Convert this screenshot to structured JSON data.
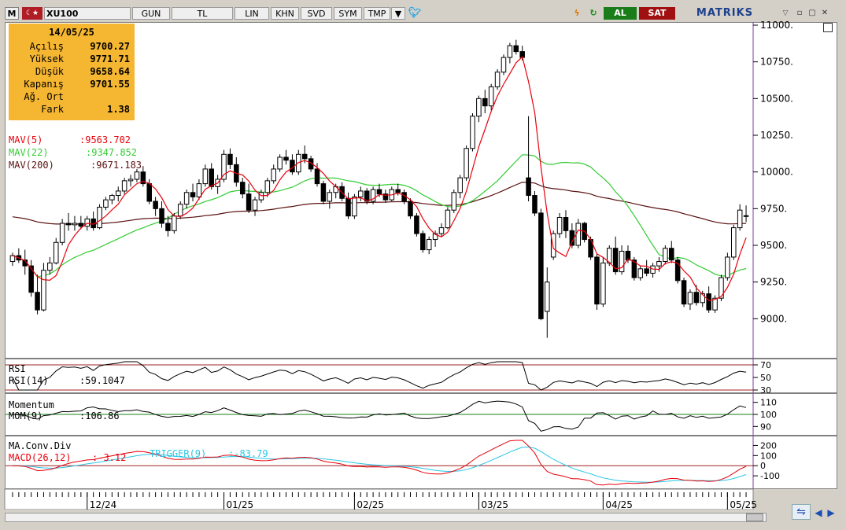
{
  "window": {
    "symbol": "XU100",
    "buttons": [
      "GUN",
      "TL",
      "LIN",
      "KHN",
      "SVD",
      "SYM",
      "TMP"
    ],
    "buy_label": "AL",
    "sell_label": "SAT",
    "brand": "MATRIKS"
  },
  "infobox": {
    "date": "14/05/25",
    "rows": [
      {
        "label": "Açılış",
        "value": "9700.27"
      },
      {
        "label": "Yüksek",
        "value": "9771.71"
      },
      {
        "label": "Düşük",
        "value": "9658.64"
      },
      {
        "label": "Kapanış",
        "value": "9701.55"
      },
      {
        "label": "Ağ. Ort",
        "value": ""
      },
      {
        "label": "Fark",
        "value": "1.38"
      }
    ]
  },
  "colors": {
    "mav5": "#e8000b",
    "mav22": "#33cc33",
    "mav200": "#5a1010",
    "macd": "#e8000b",
    "trigger": "#29c6e6",
    "price_bg": "#ffffff",
    "info_bg": "#f5b631"
  },
  "legends": {
    "mav5": {
      "name": "MAV(5)",
      "value": ":9563.702"
    },
    "mav22": {
      "name": "MAV(22)",
      "value": ":9347.852"
    },
    "mav200": {
      "name": "MAV(200)",
      "value": ":9671.183"
    },
    "rsi_title": "RSI",
    "rsi": {
      "name": "RSI(14)",
      "value": ":59.1047"
    },
    "mom_title": "Momentum",
    "mom": {
      "name": "MOM(9)",
      "value": ":106.86"
    },
    "macd_title": "MA.Conv.Div",
    "macd": {
      "name": "MACD(26,12)",
      "value": ":-3.12"
    },
    "trigger": {
      "name": "TRIGGER(9)",
      "value": ":-83.79"
    }
  },
  "chart_data": [
    {
      "type": "candlestick",
      "title": "XU100",
      "ylim": [
        8750,
        11000
      ],
      "y_ticks": [
        "11000.",
        "10750.",
        "10500.",
        "10250.",
        "10000.",
        "9750.",
        "9500.",
        "9250.",
        "9000."
      ],
      "x_ticks": [
        "12/24",
        "01/25",
        "02/25",
        "03/25",
        "04/25",
        "05/25"
      ],
      "candles": [
        [
          9390,
          9450,
          9360,
          9430
        ],
        [
          9430,
          9480,
          9380,
          9400
        ],
        [
          9400,
          9470,
          9300,
          9360
        ],
        [
          9360,
          9400,
          9150,
          9180
        ],
        [
          9180,
          9300,
          9030,
          9060
        ],
        [
          9060,
          9380,
          9050,
          9330
        ],
        [
          9330,
          9420,
          9300,
          9380
        ],
        [
          9380,
          9550,
          9370,
          9520
        ],
        [
          9520,
          9680,
          9500,
          9650
        ],
        [
          9650,
          9720,
          9600,
          9640
        ],
        [
          9640,
          9700,
          9600,
          9650
        ],
        [
          9650,
          9700,
          9610,
          9630
        ],
        [
          9630,
          9700,
          9600,
          9680
        ],
        [
          9680,
          9730,
          9600,
          9620
        ],
        [
          9620,
          9780,
          9610,
          9760
        ],
        [
          9760,
          9830,
          9740,
          9810
        ],
        [
          9810,
          9850,
          9780,
          9840
        ],
        [
          9840,
          9900,
          9800,
          9870
        ],
        [
          9870,
          9960,
          9850,
          9940
        ],
        [
          9940,
          9980,
          9900,
          9950
        ],
        [
          9950,
          10020,
          9930,
          10000
        ],
        [
          10000,
          10040,
          9900,
          9920
        ],
        [
          9920,
          9950,
          9780,
          9800
        ],
        [
          9800,
          9830,
          9700,
          9750
        ],
        [
          9750,
          9800,
          9620,
          9650
        ],
        [
          9650,
          9700,
          9560,
          9600
        ],
        [
          9600,
          9720,
          9580,
          9700
        ],
        [
          9700,
          9800,
          9680,
          9780
        ],
        [
          9780,
          9880,
          9750,
          9860
        ],
        [
          9860,
          9920,
          9800,
          9830
        ],
        [
          9830,
          9950,
          9810,
          9920
        ],
        [
          9920,
          10050,
          9900,
          10020
        ],
        [
          10020,
          10060,
          9880,
          9900
        ],
        [
          9900,
          9980,
          9850,
          9950
        ],
        [
          9950,
          10150,
          9930,
          10120
        ],
        [
          10120,
          10160,
          10020,
          10050
        ],
        [
          10050,
          10100,
          9900,
          9930
        ],
        [
          9930,
          9960,
          9820,
          9850
        ],
        [
          9850,
          9920,
          9720,
          9740
        ],
        [
          9740,
          9830,
          9700,
          9810
        ],
        [
          9810,
          9880,
          9790,
          9860
        ],
        [
          9860,
          9960,
          9830,
          9940
        ],
        [
          9940,
          10050,
          9920,
          10020
        ],
        [
          10020,
          10120,
          10000,
          10100
        ],
        [
          10100,
          10150,
          10050,
          10080
        ],
        [
          10080,
          10120,
          9980,
          10000
        ],
        [
          10000,
          10150,
          9980,
          10120
        ],
        [
          10120,
          10180,
          10060,
          10090
        ],
        [
          10090,
          10110,
          10000,
          10020
        ],
        [
          10020,
          10060,
          9900,
          9920
        ],
        [
          9920,
          9940,
          9780,
          9800
        ],
        [
          9800,
          9880,
          9750,
          9860
        ],
        [
          9860,
          9920,
          9820,
          9900
        ],
        [
          9900,
          9930,
          9800,
          9820
        ],
        [
          9820,
          9860,
          9680,
          9700
        ],
        [
          9700,
          9850,
          9680,
          9830
        ],
        [
          9830,
          9900,
          9800,
          9870
        ],
        [
          9870,
          9890,
          9780,
          9800
        ],
        [
          9800,
          9900,
          9780,
          9880
        ],
        [
          9880,
          9920,
          9830,
          9850
        ],
        [
          9850,
          9880,
          9790,
          9810
        ],
        [
          9810,
          9900,
          9800,
          9880
        ],
        [
          9880,
          9920,
          9840,
          9860
        ],
        [
          9860,
          9880,
          9780,
          9800
        ],
        [
          9800,
          9820,
          9680,
          9700
        ],
        [
          9700,
          9720,
          9560,
          9580
        ],
        [
          9580,
          9600,
          9450,
          9470
        ],
        [
          9470,
          9560,
          9440,
          9540
        ],
        [
          9540,
          9600,
          9490,
          9580
        ],
        [
          9580,
          9650,
          9560,
          9620
        ],
        [
          9620,
          9760,
          9610,
          9740
        ],
        [
          9740,
          9880,
          9720,
          9860
        ],
        [
          9860,
          9980,
          9820,
          9960
        ],
        [
          9960,
          10180,
          9940,
          10160
        ],
        [
          10160,
          10400,
          10140,
          10380
        ],
        [
          10380,
          10520,
          10340,
          10500
        ],
        [
          10500,
          10560,
          10400,
          10450
        ],
        [
          10450,
          10600,
          10420,
          10580
        ],
        [
          10580,
          10700,
          10560,
          10680
        ],
        [
          10680,
          10800,
          10660,
          10780
        ],
        [
          10780,
          10880,
          10740,
          10860
        ],
        [
          10860,
          10900,
          10800,
          10820
        ],
        [
          10820,
          10860,
          10760,
          10780
        ],
        [
          9960,
          10380,
          9800,
          9840
        ],
        [
          9840,
          9870,
          9700,
          9720
        ],
        [
          9720,
          9750,
          8990,
          9000
        ],
        [
          9050,
          9350,
          8870,
          9250
        ],
        [
          9420,
          9600,
          9400,
          9580
        ],
        [
          9580,
          9720,
          9550,
          9690
        ],
        [
          9690,
          9740,
          9550,
          9600
        ],
        [
          9600,
          9650,
          9480,
          9500
        ],
        [
          9500,
          9680,
          9480,
          9650
        ],
        [
          9650,
          9660,
          9520,
          9540
        ],
        [
          9540,
          9560,
          9400,
          9420
        ],
        [
          9420,
          9440,
          9060,
          9100
        ],
        [
          9100,
          9420,
          9080,
          9380
        ],
        [
          9380,
          9500,
          9360,
          9480
        ],
        [
          9480,
          9560,
          9300,
          9320
        ],
        [
          9320,
          9500,
          9300,
          9460
        ],
        [
          9460,
          9500,
          9380,
          9400
        ],
        [
          9400,
          9420,
          9260,
          9280
        ],
        [
          9280,
          9360,
          9260,
          9340
        ],
        [
          9340,
          9400,
          9290,
          9310
        ],
        [
          9310,
          9380,
          9280,
          9360
        ],
        [
          9360,
          9420,
          9320,
          9390
        ],
        [
          9390,
          9500,
          9370,
          9480
        ],
        [
          9480,
          9530,
          9380,
          9400
        ],
        [
          9400,
          9420,
          9240,
          9260
        ],
        [
          9260,
          9280,
          9080,
          9100
        ],
        [
          9100,
          9200,
          9060,
          9180
        ],
        [
          9180,
          9230,
          9090,
          9110
        ],
        [
          9110,
          9190,
          9080,
          9170
        ],
        [
          9170,
          9220,
          9040,
          9060
        ],
        [
          9060,
          9160,
          9040,
          9140
        ],
        [
          9140,
          9300,
          9120,
          9280
        ],
        [
          9280,
          9450,
          9260,
          9420
        ],
        [
          9420,
          9640,
          9400,
          9620
        ],
        [
          9620,
          9780,
          9600,
          9740
        ],
        [
          9700,
          9772,
          9659,
          9702
        ]
      ]
    },
    {
      "type": "line",
      "title": "RSI",
      "series": [
        {
          "name": "RSI(14)"
        }
      ],
      "last_value": 59.1047,
      "ylim": [
        30,
        75
      ],
      "y_ticks": [
        "70",
        "50",
        "30"
      ]
    },
    {
      "type": "line",
      "title": "Momentum",
      "series": [
        {
          "name": "MOM(9)"
        }
      ],
      "last_value": 106.86,
      "ylim": [
        85,
        115
      ],
      "y_ticks": [
        "110",
        "100",
        "90"
      ]
    },
    {
      "type": "line",
      "title": "MA.Conv.Div",
      "series": [
        {
          "name": "MACD(26,12)"
        },
        {
          "name": "TRIGGER(9)"
        }
      ],
      "last_values": {
        "macd": -3.12,
        "trigger": -83.79
      },
      "ylim": [
        -200,
        250
      ],
      "y_ticks": [
        "200",
        "100",
        "0",
        "-100"
      ]
    }
  ]
}
